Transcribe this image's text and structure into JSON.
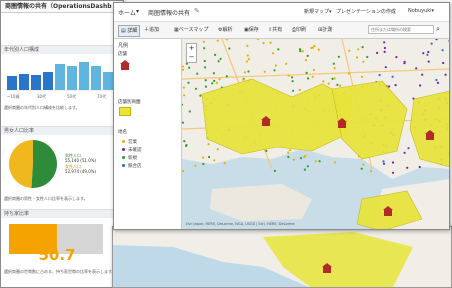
{
  "dashboard": {
    "title": "商圏情報の共有（OperationsDashb",
    "age_panel": {
      "title": "年代別人口構成",
      "tick_labels": [
        "~10歳",
        "30代",
        "50代",
        "70代"
      ],
      "desc": "選択商圏の年代別人口構成を比較します。"
    },
    "gender_panel": {
      "title": "男女人口比率",
      "male_label": "男性人口",
      "male_value": "55,140 (51.0%)",
      "female_label": "女性人口",
      "female_value": "52,974 (49.0%)",
      "desc": "選択商圏の男性・女性人口比率を表示します。",
      "chart_data": {
        "type": "pie",
        "categories": [
          "男性人口",
          "女性人口"
        ],
        "values": [
          51.0,
          49.0
        ],
        "colors": [
          "#2e8b3a",
          "#f0b71f"
        ]
      }
    },
    "share_panel": {
      "title": "持ち家比率",
      "value": "50.7",
      "level_percent": 50.7,
      "desc": "選択商圏の世帯数に占める、持ち家世帯の比率を表示します。"
    }
  },
  "map_app": {
    "breadcrumb_home": "ホーム",
    "breadcrumb_sep": "▾",
    "map_title": "商圏情報の共有",
    "new_map_label": "新規マップ▾",
    "presentation_label": "プレゼンテーションの作成",
    "user_label": "Nobuyuki▾",
    "toolbar": {
      "details": "詳細",
      "add": "追加",
      "basemap": "ベースマップ",
      "analysis": "解析",
      "save": "保存",
      "share": "共有",
      "print": "印刷",
      "measure": "計測",
      "search_placeholder": "住所または場所の検索"
    },
    "legend": {
      "title": "凡例",
      "layer1": "店舗",
      "layer2": "店舗別商圏",
      "layer3_label": "地名",
      "items": [
        {
          "label": "営業",
          "color": "#e3b200"
        },
        {
          "label": "未確認",
          "color": "#7a1fa2"
        },
        {
          "label": "新規",
          "color": "#2aa02a"
        },
        {
          "label": "競合店",
          "color": "#2a6cd0"
        }
      ]
    },
    "attribution": "Esri Japan, HERE, DeLorme, NGA, USGS | Esri, HERE, DeLorme"
  },
  "colors": {
    "trade_area": "#e8e43a",
    "water": "#c9dde9",
    "land": "#f1eee8",
    "store": "#b22a2a",
    "share_bar": "#f5a300"
  }
}
